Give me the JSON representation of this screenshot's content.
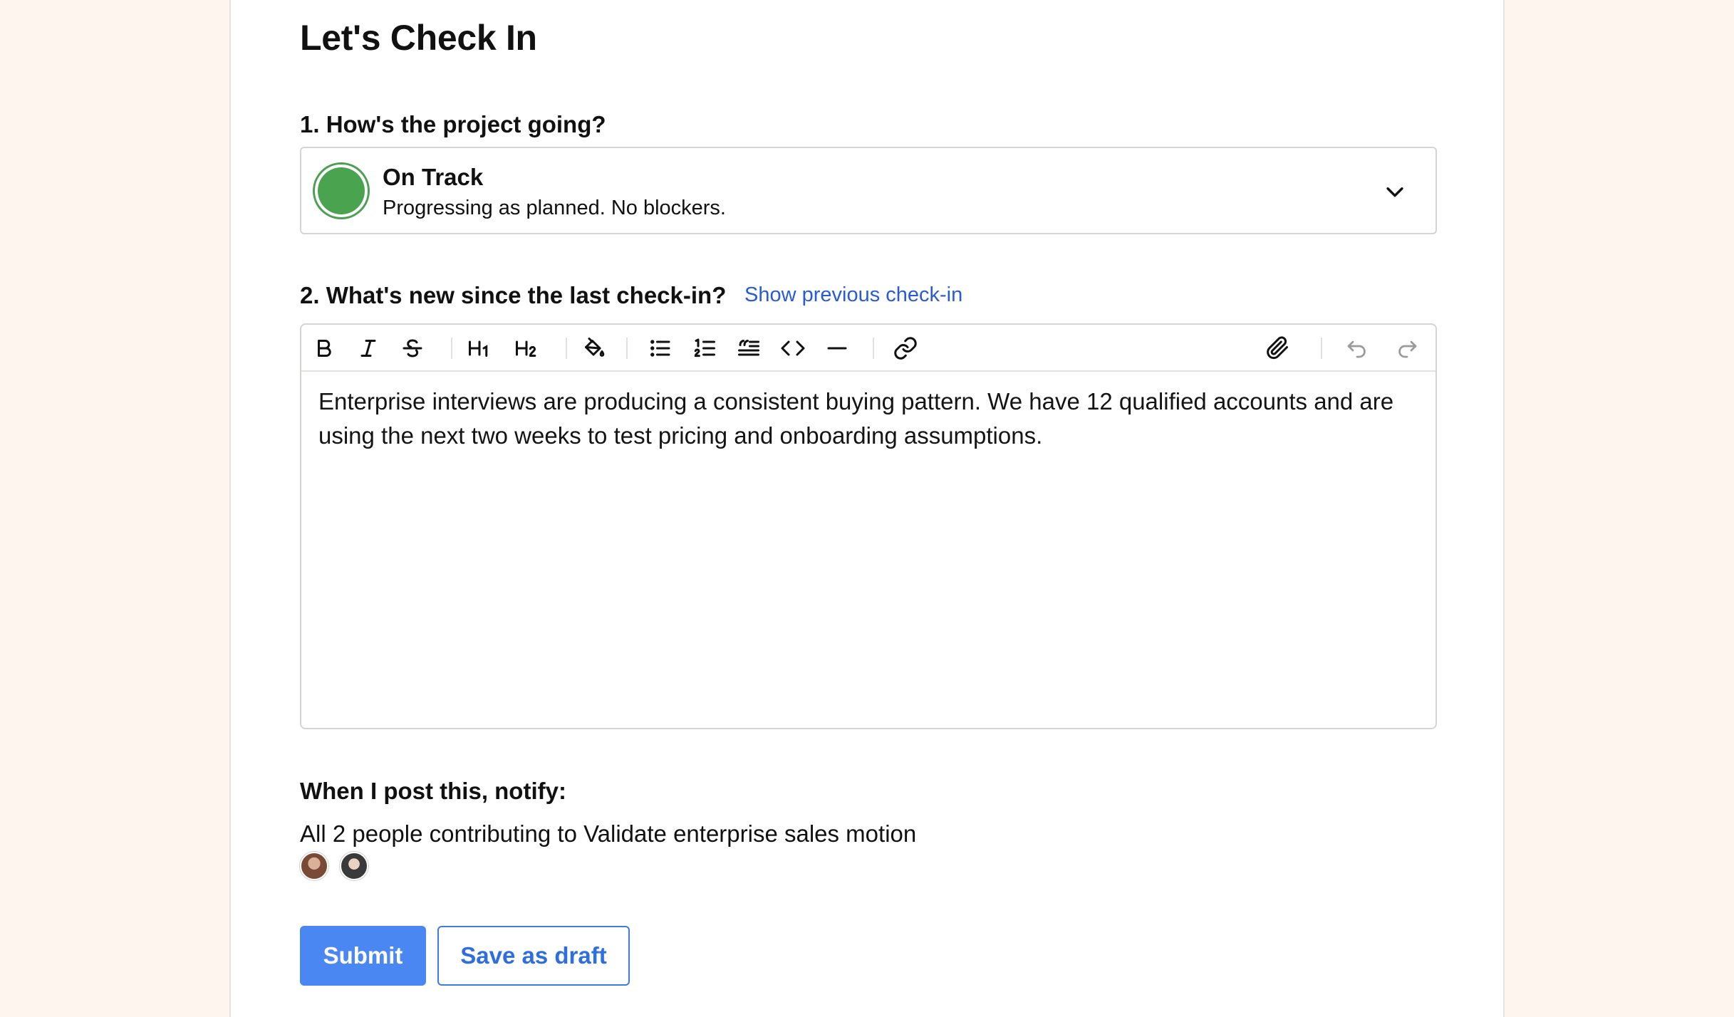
{
  "page": {
    "title": "Let's Check In"
  },
  "question1": {
    "label": "1. How's the project going?",
    "status": {
      "title": "On Track",
      "description": "Progressing as planned. No blockers.",
      "color": "#49a34f"
    }
  },
  "question2": {
    "label": "2. What's new since the last check-in?",
    "show_previous_link": "Show previous check-in",
    "editor": {
      "toolbar": [
        "bold-icon",
        "italic-icon",
        "strikethrough-icon",
        "heading1-icon",
        "heading2-icon",
        "highlight-icon",
        "bullet-list-icon",
        "numbered-list-icon",
        "blockquote-icon",
        "code-icon",
        "divider-icon",
        "link-icon",
        "attachment-icon",
        "undo-icon",
        "redo-icon"
      ],
      "content": "Enterprise interviews are producing a consistent buying pattern. We have 12 qualified accounts and are using the next two weeks to test pricing and onboarding assumptions."
    }
  },
  "notify": {
    "label": "When I post this, notify:",
    "text": "All 2 people contributing to Validate enterprise sales motion"
  },
  "actions": {
    "submit_label": "Submit",
    "draft_label": "Save as draft",
    "primary_color": "#4a87f2"
  }
}
